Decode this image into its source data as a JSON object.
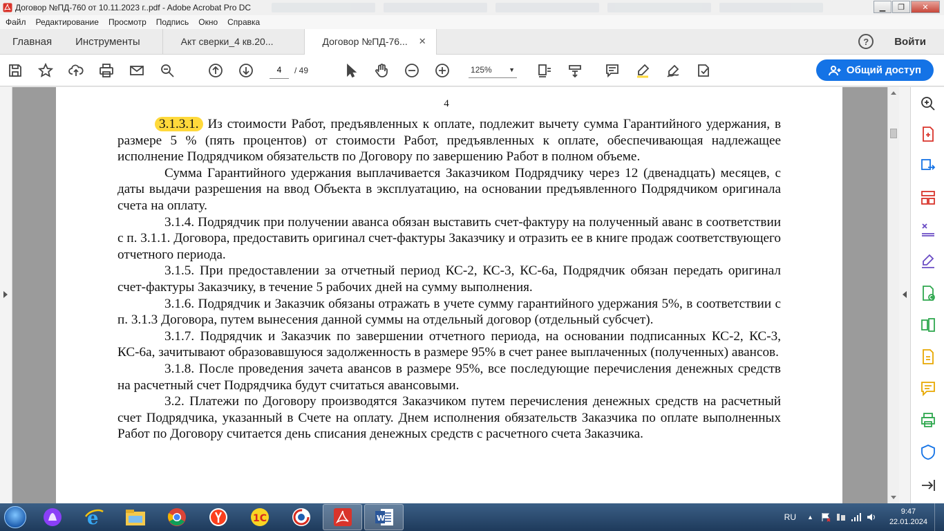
{
  "window": {
    "title": "Договор №ПД-760 от 10.11.2023 г..pdf - Adobe Acrobat Pro DC"
  },
  "menu": [
    "Файл",
    "Редактирование",
    "Просмотр",
    "Подпись",
    "Окно",
    "Справка"
  ],
  "tabs": {
    "home": "Главная",
    "tools": "Инструменты",
    "doc1": "Акт сверки_4 кв.20...",
    "doc2": "Договор №ПД-76...",
    "close_glyph": "✕",
    "help": "?",
    "signin": "Войти"
  },
  "toolbar": {
    "page_current": "4",
    "page_total": "/ 49",
    "zoom": "125%",
    "share": "Общий доступ"
  },
  "document": {
    "page_number": "4",
    "highlight": "3.1.3.1.",
    "paragraphs": [
      "Из стоимости Работ, предъявленных к оплате, подлежит вычету сумма Гарантийного удержания, в размере 5 % (пять процентов) от стоимости Работ, предъявленных к оплате, обеспечивающая надлежащее исполнение Подрядчиком обязательств по Договору по завершению Работ в полном объеме.",
      "Сумма Гарантийного удержания выплачивается Заказчиком Подрядчику через 12 (двенадцать) месяцев, с даты выдачи разрешения на ввод Объекта в эксплуатацию, на основании предъявленного Подрядчиком оригинала счета на оплату.",
      "3.1.4. Подрядчик при получении аванса обязан выставить счет-фактуру на полученный аванс в соответствии с п. 3.1.1. Договора, предоставить оригинал счет-фактуры Заказчику и отразить ее в книге продаж соответствующего отчетного периода.",
      "3.1.5. При предоставлении за отчетный период КС-2, КС-3, КС-6а, Подрядчик обязан передать оригинал счет-фактуры Заказчику, в течение 5 рабочих дней на сумму выполнения.",
      "3.1.6. Подрядчик и Заказчик обязаны отражать в учете сумму гарантийного удержания 5%, в соответствии с п. 3.1.3 Договора, путем вынесения данной суммы на отдельный договор (отдельный субсчет).",
      "3.1.7. Подрядчик и Заказчик по завершении отчетного периода, на основании подписанных КС-2, КС-3, КС-6а, зачитывают образовавшуюся задолженность в размере 95% в счет ранее выплаченных (полученных) авансов.",
      "3.1.8. После проведения зачета авансов в размере 95%, все последующие перечисления денежных средств на расчетный счет Подрядчика будут считаться авансовыми.",
      "3.2. Платежи по Договору производятся Заказчиком путем перечисления денежных средств на расчетный счет Подрядчика, указанный в Счете на оплату. Днем исполнения обязательств Заказчика по оплате выполненных Работ по Договору считается день списания денежных средств с расчетного счета Заказчика."
    ]
  },
  "right_tools": [
    "zoom-tool",
    "create-pdf",
    "export-pdf",
    "organize-pages",
    "compare",
    "fill-sign",
    "edit-pdf",
    "export-excel",
    "comment",
    "comment-bubble",
    "print-production",
    "protect",
    "more-tools"
  ],
  "taskbar": {
    "apps": [
      "alice",
      "internet-explorer",
      "file-explorer",
      "chrome",
      "yandex",
      "1c",
      "ccleaner",
      "acrobat",
      "word"
    ],
    "lang": "RU",
    "time": "9:47",
    "date": "22.01.2024"
  },
  "colors": {
    "accent": "#1473e6",
    "highlight": "#ffd93b",
    "red_icon": "#d9342b",
    "green_icon": "#2fa84f",
    "purple_icon": "#6a4bc4",
    "yellow_icon": "#e8a800"
  }
}
